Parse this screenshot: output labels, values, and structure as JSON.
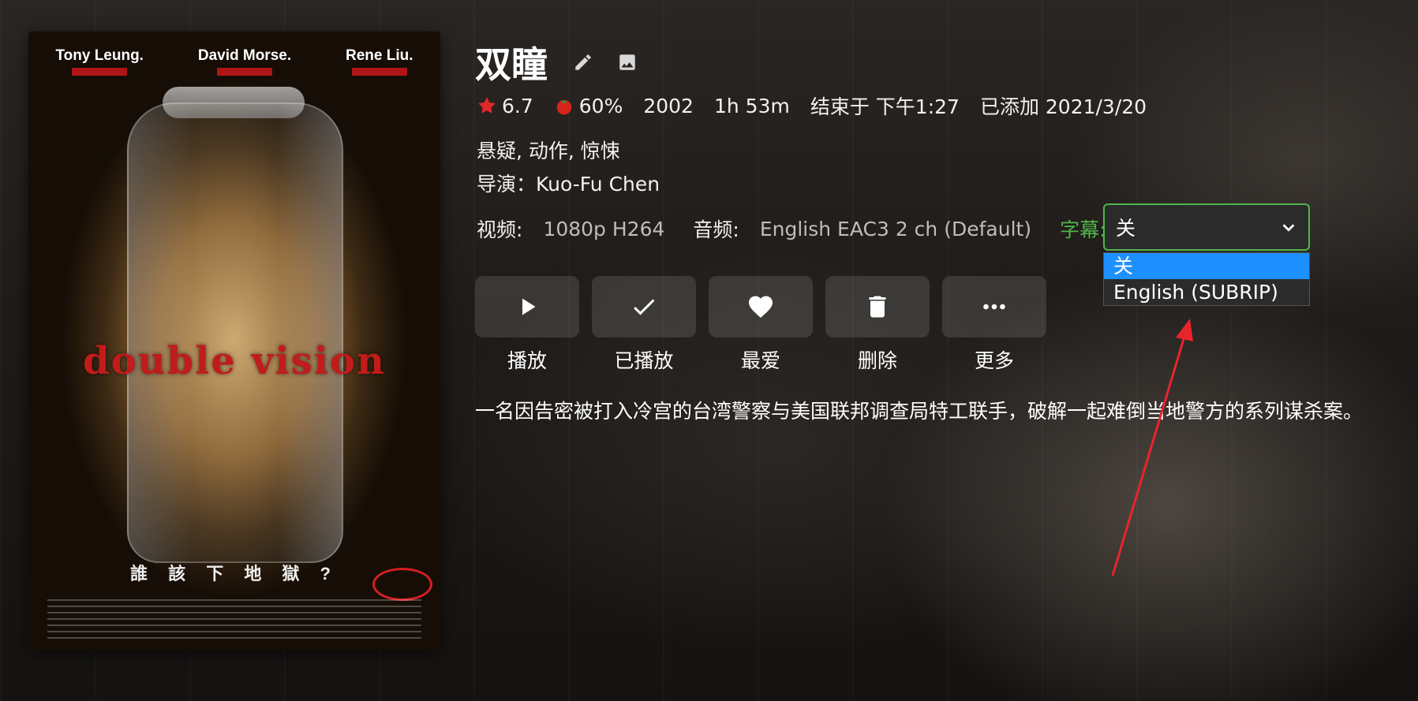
{
  "poster": {
    "cast": [
      "Tony Leung.",
      "David Morse.",
      "Rene Liu."
    ],
    "title_art": "double vision",
    "tagline": "誰 該 下 地 獄 ?"
  },
  "item": {
    "title": "双瞳",
    "rating": "6.7",
    "critic_rating": "60%",
    "year": "2002",
    "runtime": "1h 53m",
    "ends_at": "结束于 下午1:27",
    "added": "已添加 2021/3/20",
    "genres": "悬疑, 动作, 惊悚",
    "director": "导演：Kuo-Fu Chen",
    "overview": "一名因告密被打入冷宫的台湾警察与美国联邦调查局特工联手，破解一起难倒当地警方的系列谋杀案。"
  },
  "media": {
    "video_label": "视频:",
    "video_value": "1080p H264",
    "audio_label": "音频:",
    "audio_value": "English EAC3 2 ch (Default)",
    "subtitle_label": "字幕:",
    "subtitle_selected": "关",
    "subtitle_options": [
      "关",
      "English (SUBRIP)"
    ]
  },
  "actions": [
    {
      "label": "播放",
      "icon": "play-icon"
    },
    {
      "label": "已播放",
      "icon": "check-icon"
    },
    {
      "label": "最爱",
      "icon": "heart-icon"
    },
    {
      "label": "删除",
      "icon": "trash-icon"
    },
    {
      "label": "更多",
      "icon": "more-icon"
    }
  ],
  "colors": {
    "accent_green": "#52b54b",
    "selected_option": "#1e90ff",
    "star": "#e02828",
    "annotation_arrow": "#e8252b"
  }
}
